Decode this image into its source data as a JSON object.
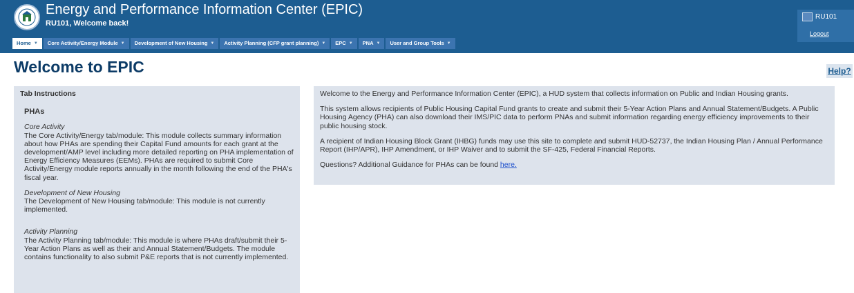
{
  "header": {
    "app_title": "Energy and Performance Information Center (EPIC)",
    "welcome": "RU101, Welcome back!",
    "user": {
      "name": "RU101",
      "logout": "Logout"
    }
  },
  "nav": {
    "tabs": [
      {
        "label": "Home"
      },
      {
        "label": "Core Activity/Energy Module"
      },
      {
        "label": "Development of New Housing"
      },
      {
        "label": "Activity Planning (CFP grant planning)"
      },
      {
        "label": "EPC"
      },
      {
        "label": "PNA"
      },
      {
        "label": "User and Group Tools"
      }
    ]
  },
  "page": {
    "title": "Welcome to EPIC",
    "help": "Help?"
  },
  "left": {
    "heading": "Tab Instructions",
    "pha_heading": "PHAs",
    "sections": [
      {
        "title": "Core Activity",
        "body": "The Core Activity/Energy tab/module: This module collects summary information about how PHAs are spending their Capital Fund amounts for each grant at the development/AMP level including more detailed reporting on PHA implementation of Energy Efficiency Measures (EEMs). PHAs are required to submit Core Activity/Energy module reports annually in the month following the end of the PHA's fiscal year."
      },
      {
        "title": "Development of New Housing",
        "body": "The Development of New Housing tab/module: This module is not currently implemented."
      },
      {
        "title": "Activity Planning",
        "body": "The Activity Planning tab/module: This module is where PHAs draft/submit their 5-Year Action Plans as well as their and Annual Statement/Budgets. The module contains functionality to also submit P&E reports that is not currently implemented."
      }
    ]
  },
  "right": {
    "p1": "Welcome to the Energy and Performance Information Center (EPIC), a HUD system that collects information on Public and Indian Housing grants.",
    "p2": "This system allows recipients of Public Housing Capital Fund grants to create and submit their 5-Year Action Plans and Annual Statement/Budgets. A Public Housing Agency (PHA) can also download their IMS/PIC data to perform PNAs and submit information regarding energy efficiency improvements to their public housing stock.",
    "p3": "A recipient of Indian Housing Block Grant (IHBG) funds may use this site to complete and submit HUD-52737, the Indian Housing Plan / Annual Performance Report (IHP/APR), IHP Amendment, or IHP Waiver and to submit the SF-425, Federal Financial Reports.",
    "p4": "Questions? Additional Guidance for PHAs can be found",
    "here": "here."
  }
}
